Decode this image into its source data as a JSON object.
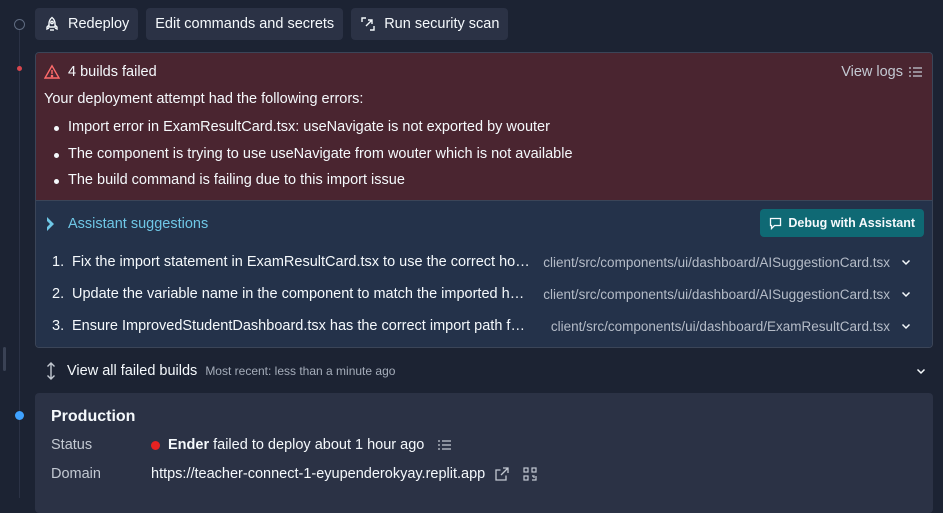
{
  "toolbar": {
    "redeploy": "Redeploy",
    "edit": "Edit commands and secrets",
    "scan": "Run security scan"
  },
  "errors": {
    "title": "4 builds failed",
    "view_logs": "View logs",
    "intro": "Your deployment attempt had the following errors:",
    "items": [
      "Import error in ExamResultCard.tsx: useNavigate is not exported by wouter",
      "The component is trying to use useNavigate from wouter which is not available",
      "The build command is failing due to this import issue"
    ]
  },
  "suggestions": {
    "title": "Assistant suggestions",
    "debug_button": "Debug with Assistant",
    "items": [
      {
        "num": "1.",
        "text": "Fix the import statement in ExamResultCard.tsx to use the correct hook from wouter",
        "path": "client/src/components/ui/dashboard/AISuggestionCard.tsx"
      },
      {
        "num": "2.",
        "text": "Update the variable name in the component to match the imported hook",
        "path": "client/src/components/ui/dashboard/AISuggestionCard.tsx"
      },
      {
        "num": "3.",
        "text": "Ensure ImprovedStudentDashboard.tsx has the correct import path for the component",
        "path": "client/src/components/ui/dashboard/ExamResultCard.tsx"
      }
    ]
  },
  "failed_builds": {
    "label": "View all failed builds",
    "recent": "Most recent: less than a minute ago"
  },
  "production": {
    "title": "Production",
    "status_label": "Status",
    "status_user": "Ender",
    "status_text": " failed to deploy about 1 hour ago",
    "domain_label": "Domain",
    "domain_value": "https://teacher-connect-1-eyupenderokyay.replit.app"
  },
  "colors": {
    "background": "#1c2333",
    "error_bg": "#4a2530",
    "suggestion_bg": "#24324a",
    "accent_teal": "#0f6974",
    "link_cyan": "#6fc7e6",
    "status_red": "#e52222",
    "active_blue": "#3fa2ff"
  }
}
